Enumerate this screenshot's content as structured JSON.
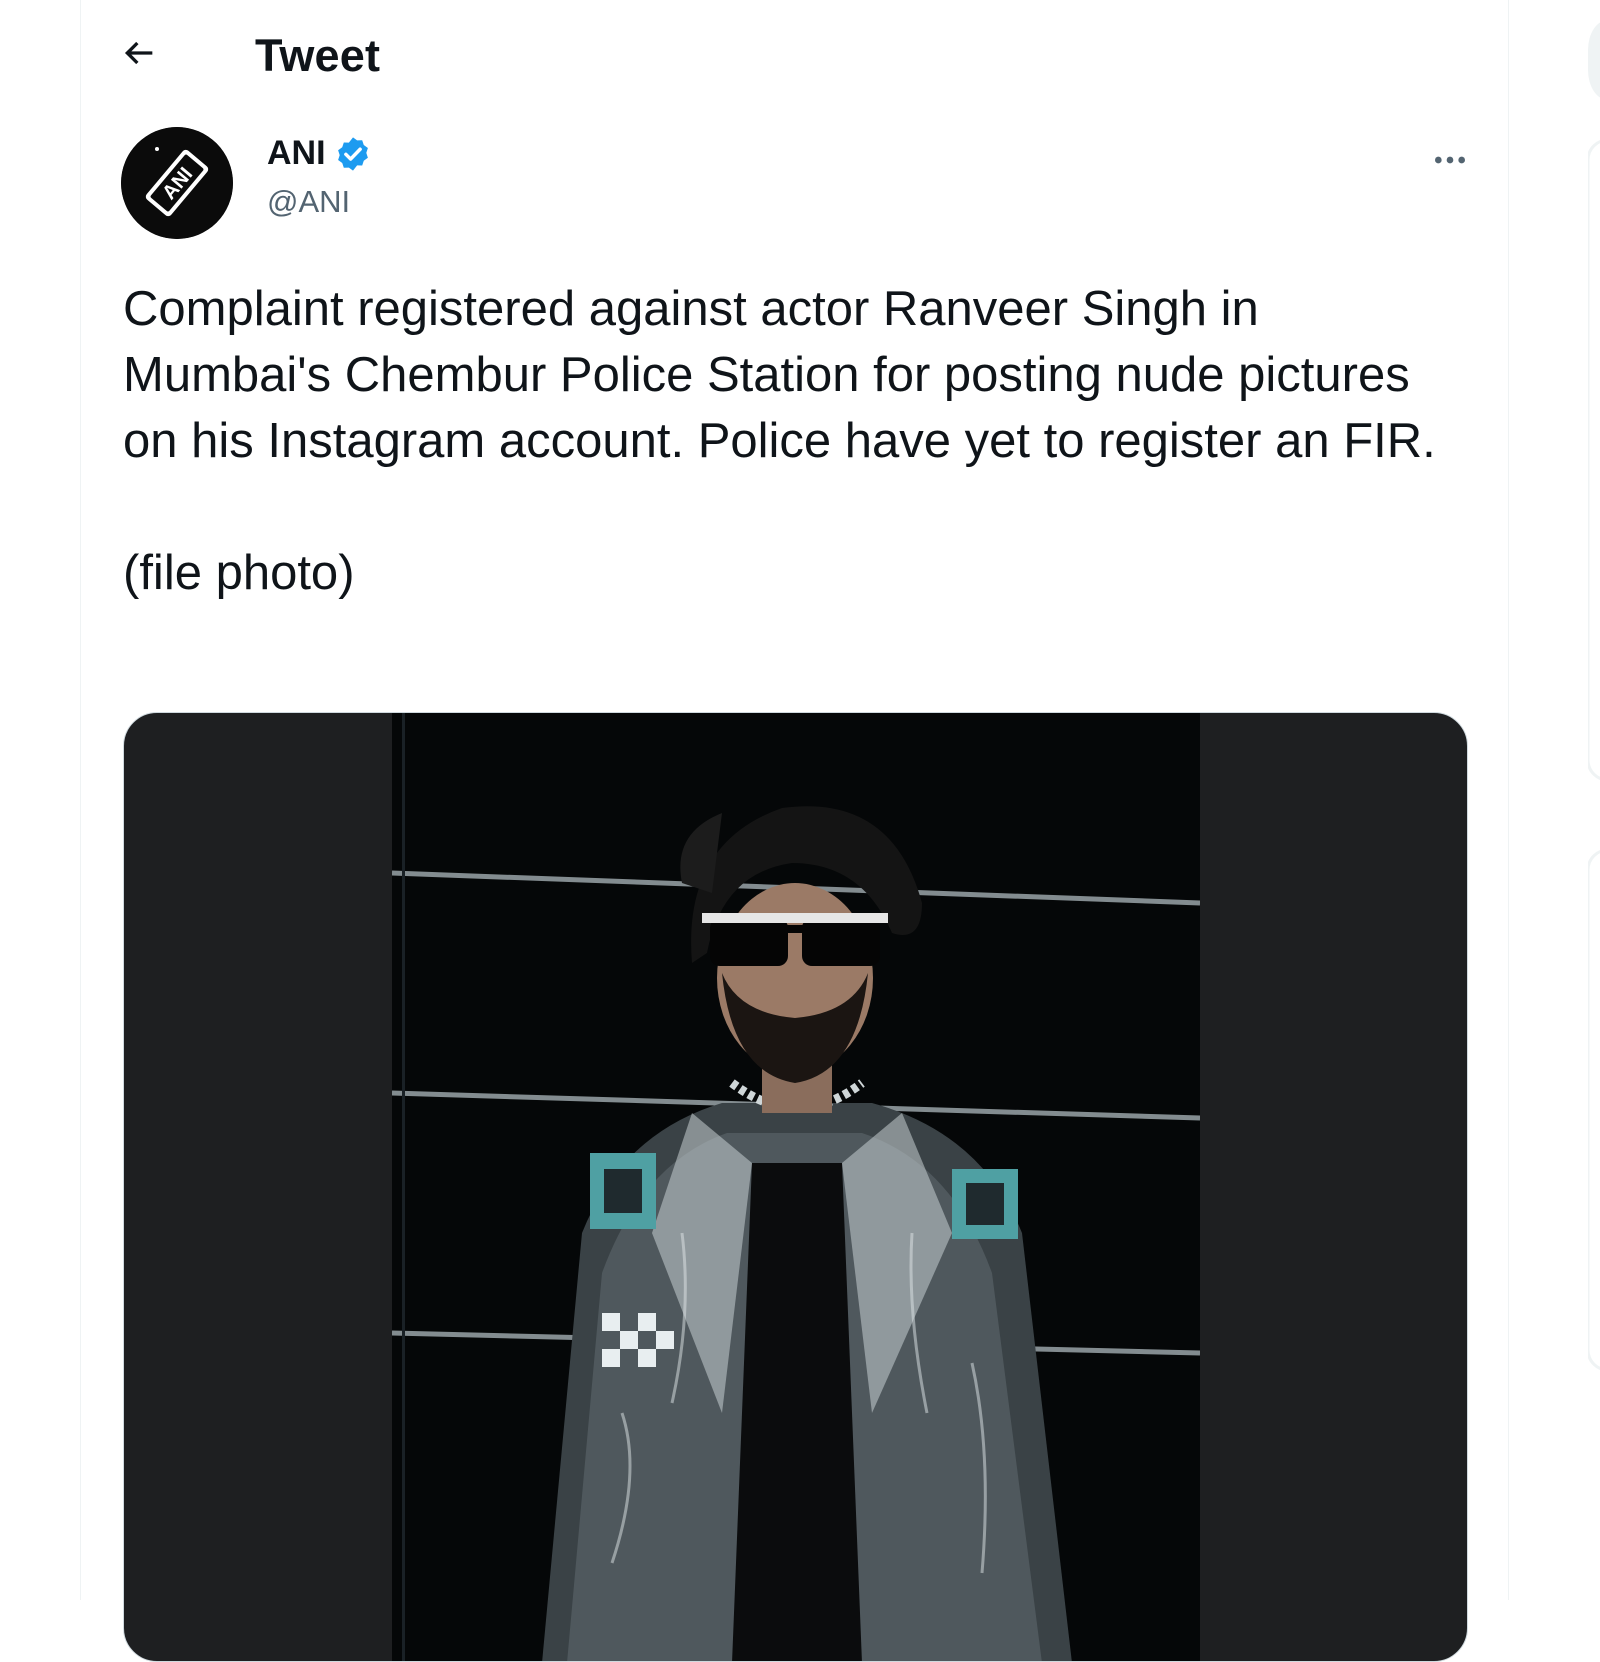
{
  "header": {
    "title": "Tweet"
  },
  "tweet": {
    "author": {
      "name": "ANI",
      "handle": "@ANI",
      "avatar_text": "ANI",
      "verified": true
    },
    "text": "Complaint registered against actor Ranveer Singh in Mumbai's Chembur Police Station for posting nude pictures on his Instagram account. Police have yet to register an FIR.\n\n(file photo)"
  },
  "colors": {
    "accent": "#1d9bf0",
    "text_primary": "#0f1419",
    "text_secondary": "#536471",
    "media_background": "#1e1f21"
  },
  "icons": {
    "back": "back-arrow-icon",
    "verified": "verified-badge-icon",
    "more": "more-options-icon"
  }
}
